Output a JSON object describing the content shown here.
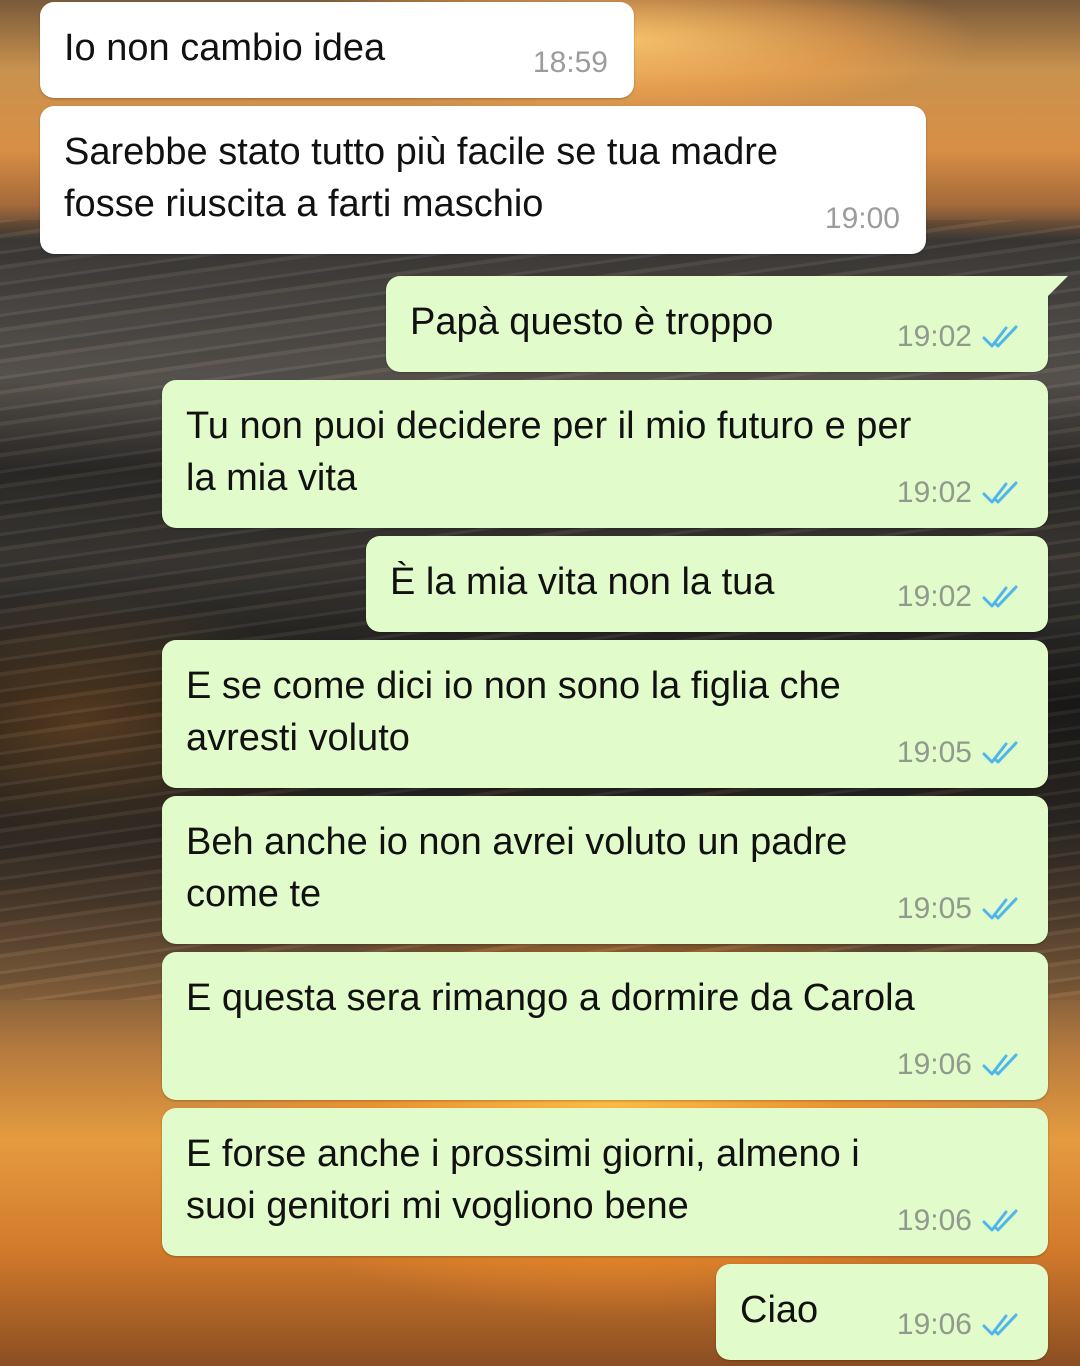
{
  "messages": [
    {
      "direction": "incoming",
      "text": "Io non cambio idea",
      "time": "18:59"
    },
    {
      "direction": "incoming",
      "text": "Sarebbe stato tutto più facile se tua madre\nfosse riuscita a farti maschio",
      "time": "19:00"
    },
    {
      "direction": "outgoing",
      "text": "Papà questo è troppo",
      "time": "19:02",
      "status": "read"
    },
    {
      "direction": "outgoing",
      "text": "Tu non puoi decidere per il mio futuro e per\nla mia vita",
      "time": "19:02",
      "status": "read"
    },
    {
      "direction": "outgoing",
      "text": "È la mia vita non la tua",
      "time": "19:02",
      "status": "read"
    },
    {
      "direction": "outgoing",
      "text": "E se come dici io non sono la figlia che\navresti voluto",
      "time": "19:05",
      "status": "read"
    },
    {
      "direction": "outgoing",
      "text": "Beh anche io non avrei voluto un padre\ncome te",
      "time": "19:05",
      "status": "read"
    },
    {
      "direction": "outgoing",
      "text": "E questa sera rimango a dormire da Carola",
      "time": "19:06",
      "status": "read"
    },
    {
      "direction": "outgoing",
      "text": "E forse anche i prossimi giorni, almeno i\nsuoi genitori mi vogliono bene",
      "time": "19:06",
      "status": "read"
    },
    {
      "direction": "outgoing",
      "text": "Ciao",
      "time": "19:06",
      "status": "read"
    }
  ],
  "colors": {
    "incoming_bubble": "#ffffff",
    "outgoing_bubble": "#e2fbcb",
    "read_tick": "#4fb6ec"
  },
  "icons": {
    "read_status": "double-check-icon"
  }
}
